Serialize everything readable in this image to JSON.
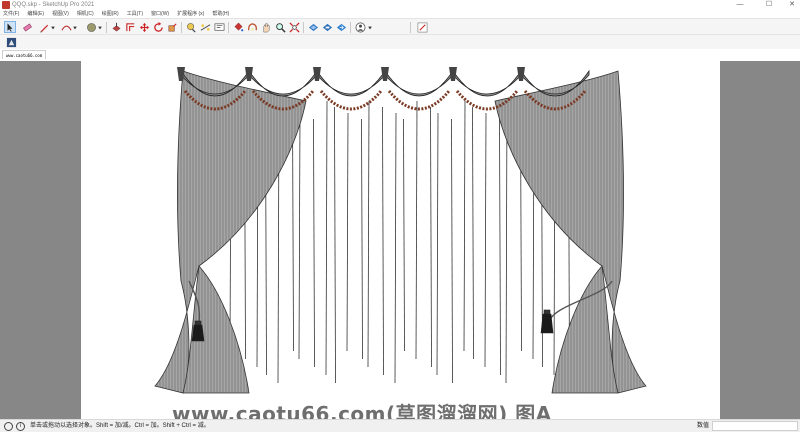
{
  "window": {
    "title": "QQQ.skp - SketchUp Pro 2021",
    "minimize": "—",
    "maximize": "☐",
    "close": "✕"
  },
  "menu": [
    "文件(F)",
    "编辑(E)",
    "视图(V)",
    "相机(C)",
    "绘图(R)",
    "工具(T)",
    "窗口(W)",
    "扩展程序 (x)",
    "帮助(H)"
  ],
  "toolbar": {
    "tools": [
      {
        "name": "select-tool-icon",
        "active": true
      },
      {
        "name": "eraser-tool-icon"
      },
      {
        "name": "pencil-line-tool-icon",
        "dropdown": true
      },
      {
        "name": "arc-tool-icon",
        "dropdown": true
      },
      {
        "name": "shape-tool-icon",
        "dropdown": true
      },
      {
        "name": "push-pull-tool-icon"
      },
      {
        "name": "offset-tool-icon"
      },
      {
        "name": "move-tool-icon"
      },
      {
        "name": "rotate-tool-icon"
      },
      {
        "name": "scale-tool-icon"
      },
      {
        "name": "tape-measure-tool-icon"
      },
      {
        "name": "dimension-tool-icon"
      },
      {
        "name": "text-tool-icon"
      },
      {
        "name": "paint-bucket-tool-icon"
      },
      {
        "name": "orbit-tool-icon"
      },
      {
        "name": "pan-tool-icon"
      },
      {
        "name": "zoom-tool-icon"
      },
      {
        "name": "zoom-extents-tool-icon"
      },
      {
        "name": "3d-warehouse-icon"
      },
      {
        "name": "extension-warehouse-icon"
      },
      {
        "name": "layout-send-icon"
      },
      {
        "name": "account-icon",
        "dropdown": true
      },
      {
        "name": "style-builder-icon"
      }
    ]
  },
  "tab": {
    "label": "www.caotu66.com"
  },
  "watermark": "www.caotu66.com(草图溜溜网) 图A",
  "status": {
    "hint": "单击或拖动以选择对象。Shift = 加/减。Ctrl = 加。Shift + Ctrl = 减。",
    "measurements_label": "数值",
    "measurements_value": ""
  },
  "colors": {
    "viewport_bg": "#878787",
    "toolbar_bg": "#f5f5f5",
    "curtain_fill": "#9b9b9b",
    "valance_trim": "#7a3a24"
  }
}
